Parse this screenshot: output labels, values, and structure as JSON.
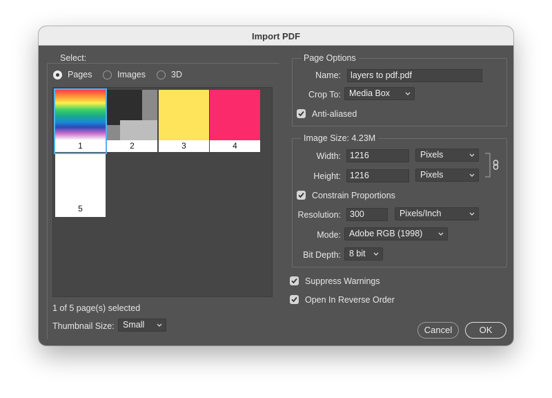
{
  "window": {
    "title": "Import PDF"
  },
  "select_group": {
    "legend": "Select:",
    "modes": [
      {
        "label": "Pages",
        "selected": true
      },
      {
        "label": "Images",
        "selected": false
      },
      {
        "label": "3D",
        "selected": false
      }
    ],
    "pages": [
      {
        "number": "1",
        "selected": true
      },
      {
        "number": "2",
        "selected": false
      },
      {
        "number": "3",
        "selected": false
      },
      {
        "number": "4",
        "selected": false
      },
      {
        "number": "5",
        "selected": false
      }
    ],
    "status": "1 of 5 page(s) selected",
    "thumbnail_size_label": "Thumbnail Size:",
    "thumbnail_size_value": "Small"
  },
  "page_options": {
    "legend": "Page Options",
    "name_label": "Name:",
    "name_value": "layers to pdf.pdf",
    "crop_label": "Crop To:",
    "crop_value": "Media Box",
    "anti_aliased_label": "Anti-aliased",
    "anti_aliased_checked": true
  },
  "image_size": {
    "legend": "Image Size: 4.23M",
    "width_label": "Width:",
    "width_value": "1216",
    "width_unit": "Pixels",
    "height_label": "Height:",
    "height_value": "1216",
    "height_unit": "Pixels",
    "constrain_label": "Constrain Proportions",
    "constrain_checked": true,
    "resolution_label": "Resolution:",
    "resolution_value": "300",
    "resolution_unit": "Pixels/Inch",
    "mode_label": "Mode:",
    "mode_value": "Adobe RGB (1998)",
    "bit_depth_label": "Bit Depth:",
    "bit_depth_value": "8 bit"
  },
  "options": {
    "suppress_warnings_label": "Suppress Warnings",
    "suppress_warnings_checked": true,
    "reverse_order_label": "Open In Reverse Order",
    "reverse_order_checked": true
  },
  "buttons": {
    "cancel": "Cancel",
    "ok": "OK"
  },
  "colors": {
    "panel": "#535353",
    "selection_outline": "#4fb3e8",
    "page3": "#fde45a",
    "page4": "#fa2a6b",
    "page5": "#ffffff"
  },
  "icons": [
    "link-chain-icon",
    "chevron-down-icon",
    "checkmark-icon"
  ]
}
